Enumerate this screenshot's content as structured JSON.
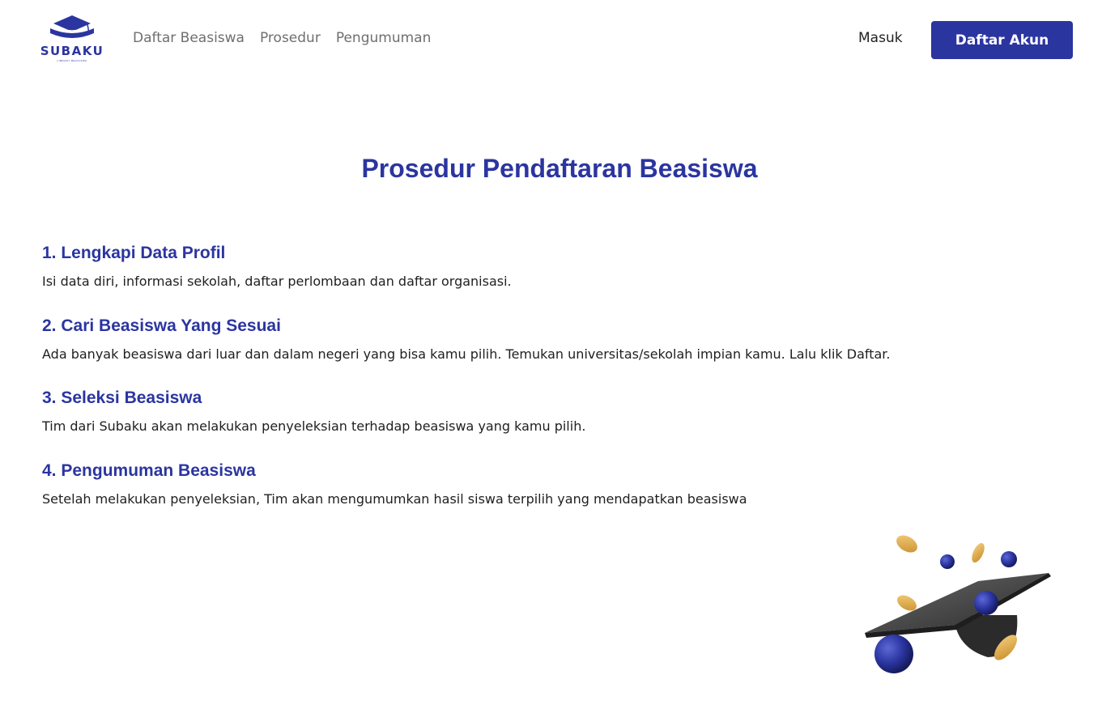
{
  "brand": {
    "name": "SUBAKU",
    "tagline": "LIBRARY BEASISWA",
    "primary_color": "#2b35a0"
  },
  "nav": {
    "items": [
      {
        "label": "Daftar Beasiswa"
      },
      {
        "label": "Prosedur"
      },
      {
        "label": "Pengumuman"
      }
    ],
    "login_label": "Masuk",
    "register_label": "Daftar Akun"
  },
  "main": {
    "title": "Prosedur Pendaftaran Beasiswa",
    "steps": [
      {
        "title": "1. Lengkapi Data Profil",
        "description": "Isi data diri, informasi sekolah, daftar perlombaan dan daftar organisasi."
      },
      {
        "title": "2. Cari Beasiswa Yang Sesuai",
        "description": "Ada banyak beasiswa dari luar dan dalam negeri yang bisa kamu pilih. Temukan universitas/sekolah impian kamu. Lalu klik Daftar."
      },
      {
        "title": "3. Seleksi Beasiswa",
        "description": "Tim dari Subaku akan melakukan penyeleksian terhadap beasiswa yang kamu pilih."
      },
      {
        "title": "4. Pengumuman Beasiswa",
        "description": "Setelah melakukan penyeleksian, Tim akan mengumumkan hasil siswa terpilih yang mendapatkan beasiswa"
      }
    ]
  },
  "illustration": {
    "icon": "graduation-cap-with-coins-icon"
  }
}
